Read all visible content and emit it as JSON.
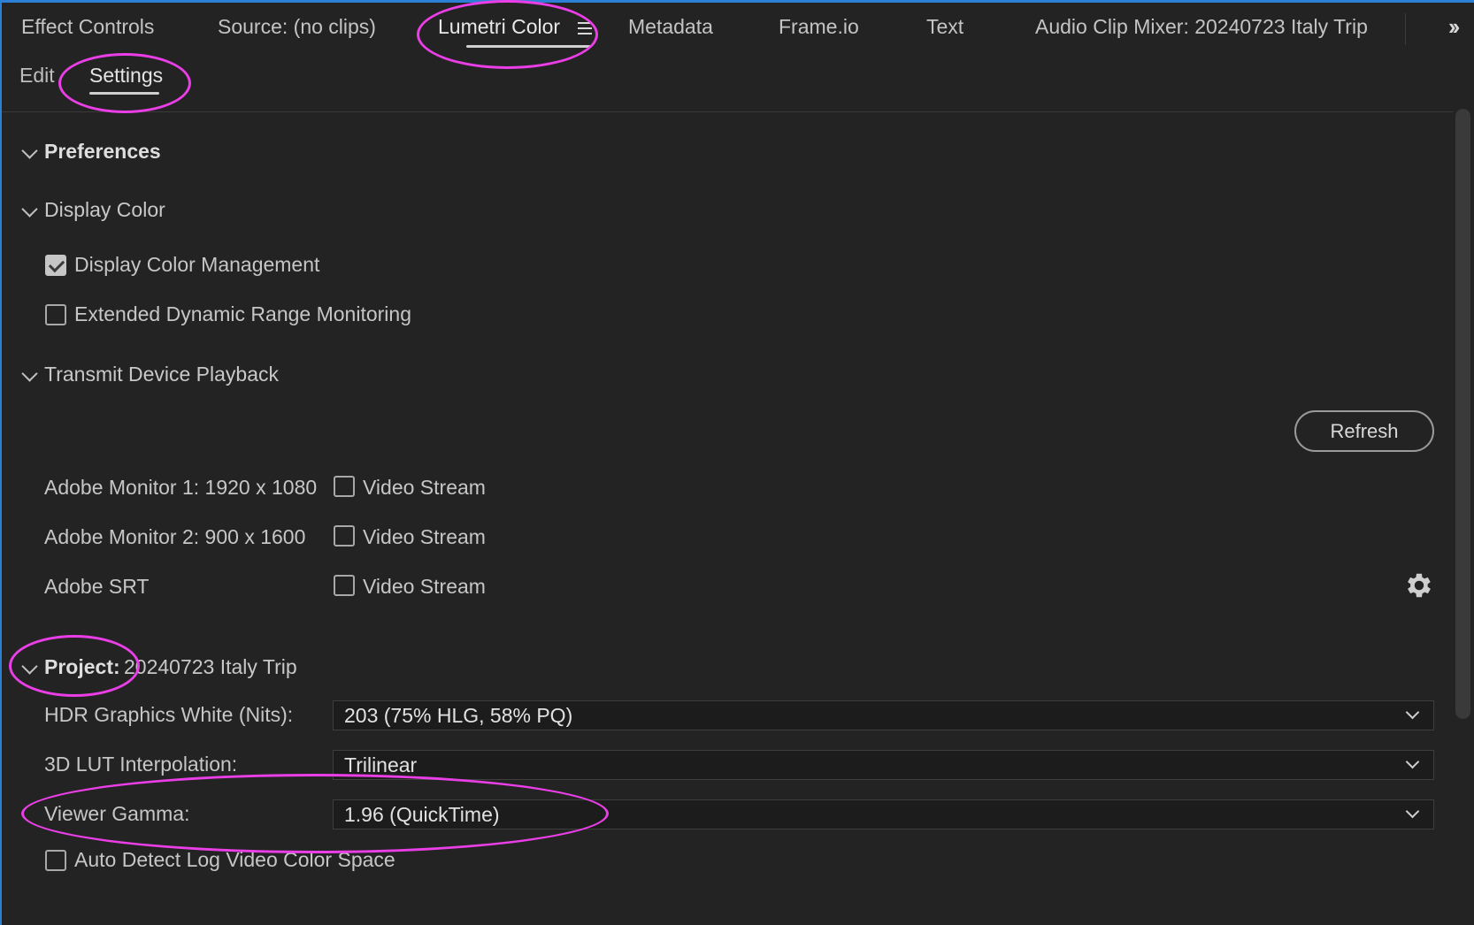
{
  "panel_tabs": [
    "Effect Controls",
    "Source: (no clips)",
    "Lumetri Color",
    "Metadata",
    "Frame.io",
    "Text",
    "Audio Clip Mixer: 20240723 Italy Trip"
  ],
  "sub_tabs": [
    "Edit",
    "Settings"
  ],
  "sections": {
    "preferences": "Preferences",
    "display_color": "Display Color",
    "transmit": "Transmit Device Playback",
    "project_label": "Project:",
    "project_name": "20240723 Italy Trip"
  },
  "display_color": {
    "management": {
      "label": "Display Color Management",
      "checked": true
    },
    "edr": {
      "label": "Extended Dynamic Range Monitoring",
      "checked": false
    }
  },
  "transmit": {
    "refresh_label": "Refresh",
    "devices": [
      {
        "name": "Adobe Monitor 1: 1920 x 1080",
        "stream_label": "Video Stream",
        "checked": false
      },
      {
        "name": "Adobe Monitor 2: 900 x 1600",
        "stream_label": "Video Stream",
        "checked": false
      },
      {
        "name": "Adobe SRT",
        "stream_label": "Video Stream",
        "checked": false
      }
    ]
  },
  "project": {
    "hdr_white": {
      "label": "HDR Graphics White (Nits):",
      "value": "203 (75% HLG, 58% PQ)"
    },
    "lut": {
      "label": "3D LUT Interpolation:",
      "value": "Trilinear"
    },
    "gamma": {
      "label": "Viewer Gamma:",
      "value": "1.96 (QuickTime)"
    },
    "auto_detect": {
      "label": "Auto Detect Log Video Color Space",
      "checked": false
    }
  },
  "colors": {
    "accent": "#2b7fd4",
    "annotation": "#ea3ee6"
  },
  "icons": [
    "panel-menu-icon",
    "overflow-chevrons-icon",
    "gear-icon"
  ]
}
